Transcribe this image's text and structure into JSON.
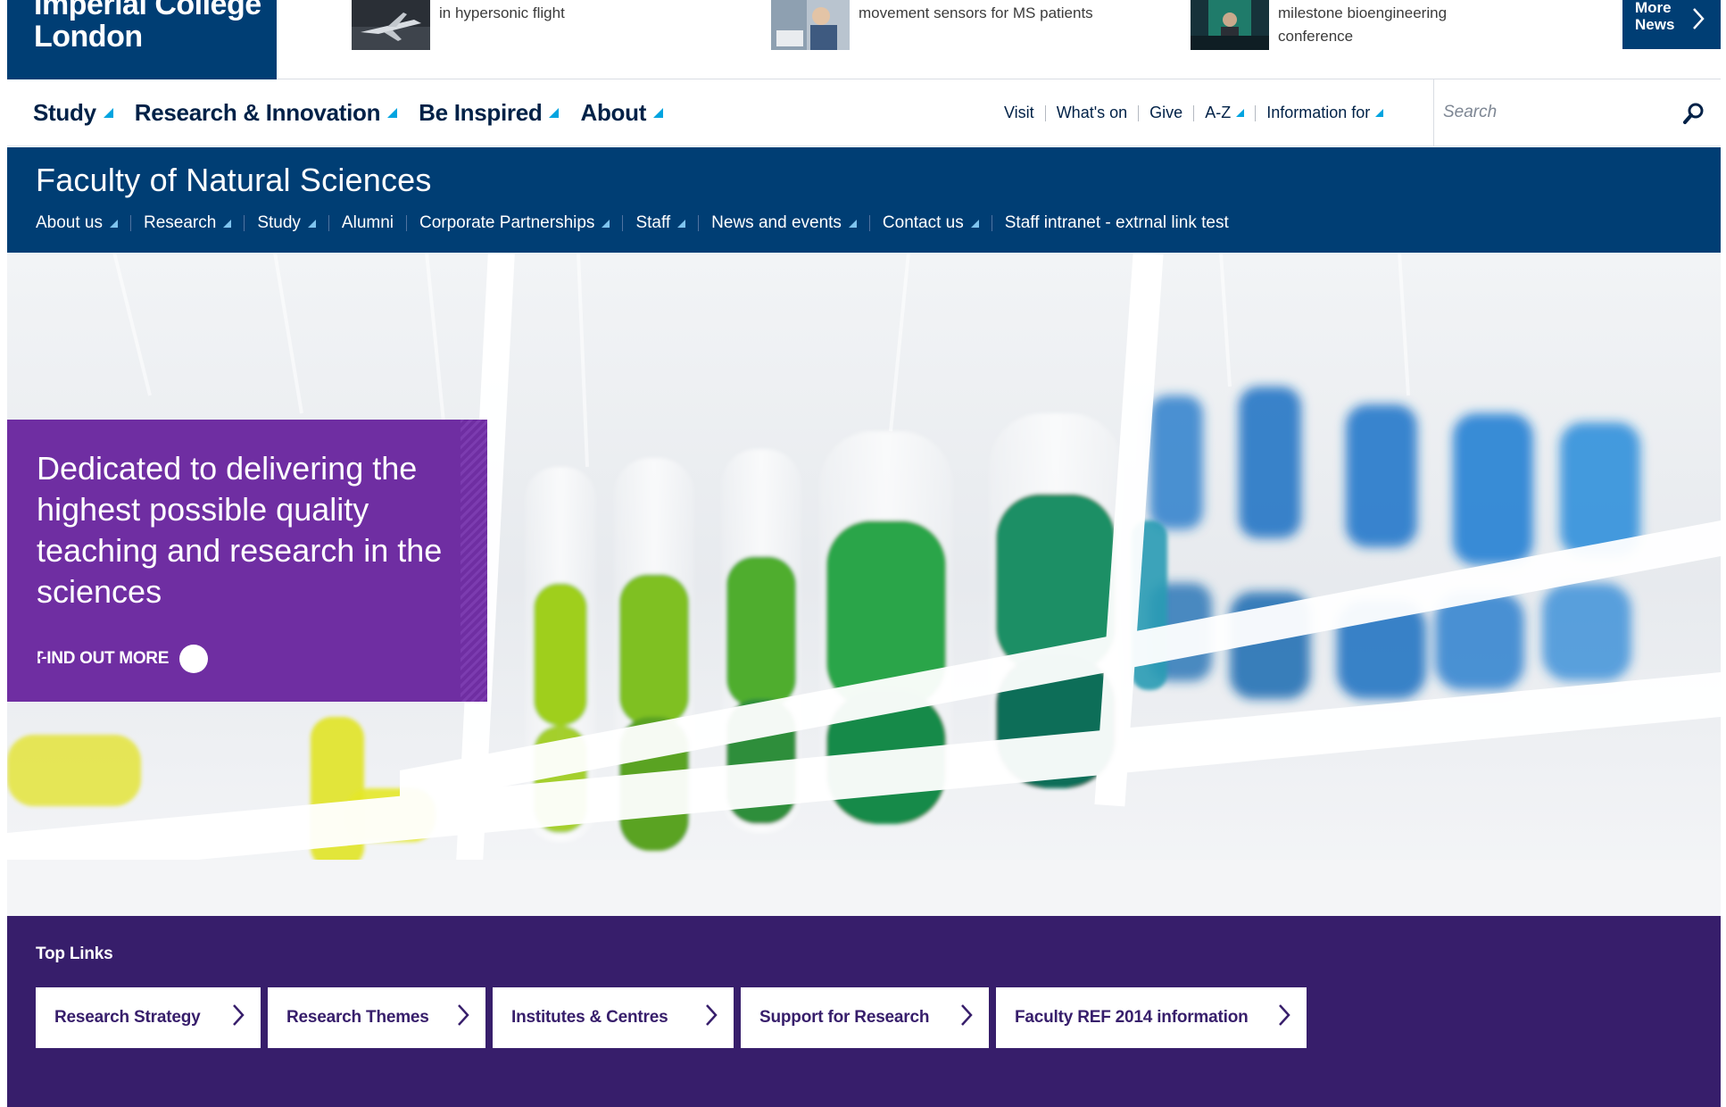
{
  "logo": {
    "line1": "Imperial College",
    "line2": "London"
  },
  "news": [
    {
      "text_lines": [
        "in hypersonic flight"
      ]
    },
    {
      "text_lines": [
        "movement sensors for MS patients"
      ]
    },
    {
      "text_lines": [
        "milestone bioengineering",
        "conference"
      ]
    }
  ],
  "more_news": {
    "line1": "More",
    "line2": "News"
  },
  "main_nav": {
    "primary": [
      {
        "label": "Study"
      },
      {
        "label": "Research & Innovation"
      },
      {
        "label": "Be Inspired"
      },
      {
        "label": "About"
      }
    ],
    "secondary": [
      {
        "label": "Visit",
        "dropdown": false
      },
      {
        "label": "What's on",
        "dropdown": false
      },
      {
        "label": "Give",
        "dropdown": false
      },
      {
        "label": "A-Z",
        "dropdown": true
      },
      {
        "label": "Information for",
        "dropdown": true
      }
    ],
    "search": {
      "placeholder": "Search"
    }
  },
  "faculty": {
    "title": "Faculty of Natural Sciences",
    "subnav": [
      {
        "label": "About us",
        "dropdown": true
      },
      {
        "label": "Research",
        "dropdown": true
      },
      {
        "label": "Study",
        "dropdown": true
      },
      {
        "label": "Alumni",
        "dropdown": false
      },
      {
        "label": "Corporate Partnerships",
        "dropdown": true
      },
      {
        "label": "Staff",
        "dropdown": true
      },
      {
        "label": "News and events",
        "dropdown": true
      },
      {
        "label": "Contact us",
        "dropdown": true
      },
      {
        "label": "Staff intranet - extrnal link test",
        "dropdown": false
      }
    ]
  },
  "hero": {
    "headline": "Dedicated to delivering the highest possible quality teaching and research in the sciences",
    "cta": "FIND OUT MORE"
  },
  "top_links": {
    "heading": "Top Links",
    "items": [
      {
        "label": "Research Strategy"
      },
      {
        "label": "Research Themes"
      },
      {
        "label": "Institutes & Centres"
      },
      {
        "label": "Support for Research"
      },
      {
        "label": "Faculty REF 2014 information"
      }
    ]
  },
  "colors": {
    "navy": "#003e74",
    "accent": "#00a4e0",
    "purple": "#6f2ea2",
    "deep_purple": "#371e6b"
  }
}
